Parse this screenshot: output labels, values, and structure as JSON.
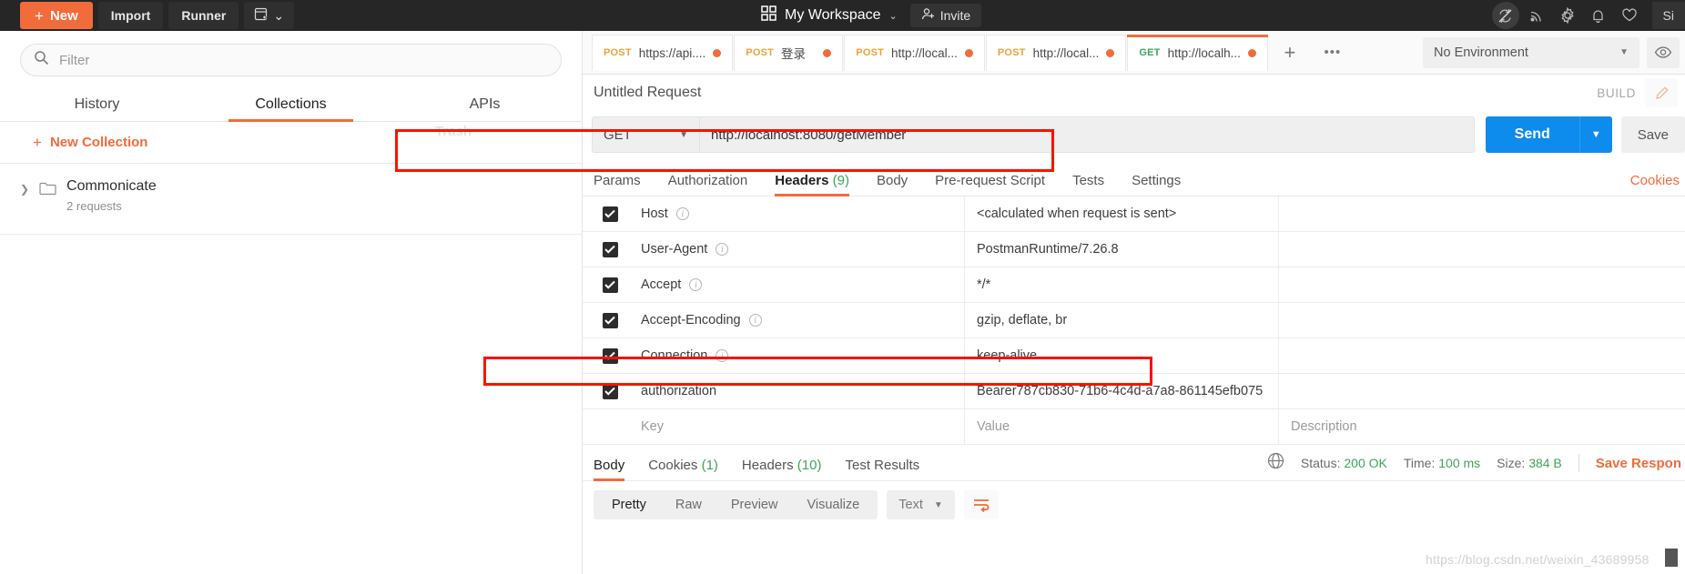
{
  "topbar": {
    "new_label": "New",
    "import_label": "Import",
    "runner_label": "Runner",
    "workspace_label": "My Workspace",
    "invite_label": "Invite",
    "signin_label": "Si",
    "icons": [
      "new-window-icon",
      "sync-off-icon",
      "broadcast-icon",
      "gear-icon",
      "bell-icon",
      "heart-icon"
    ]
  },
  "sidebar": {
    "filter_placeholder": "Filter",
    "tabs": [
      {
        "label": "History",
        "selected": false
      },
      {
        "label": "Collections",
        "selected": true
      },
      {
        "label": "APIs",
        "selected": false
      }
    ],
    "new_collection_label": "New Collection",
    "trash_label": "Trash",
    "collections": [
      {
        "name": "Commonicate",
        "sub": "2 requests"
      }
    ]
  },
  "request_tabs": [
    {
      "method": "POST",
      "name": "https://api....",
      "selected": false,
      "unsaved": true
    },
    {
      "method": "POST",
      "name": "登录",
      "selected": false,
      "unsaved": true
    },
    {
      "method": "POST",
      "name": "http://local...",
      "selected": false,
      "unsaved": true
    },
    {
      "method": "POST",
      "name": "http://local...",
      "selected": false,
      "unsaved": true
    },
    {
      "method": "GET",
      "name": "http://localh...",
      "selected": true,
      "unsaved": true
    }
  ],
  "environment": {
    "selected": "No Environment",
    "eye_icon": "eye-icon"
  },
  "request": {
    "title": "Untitled Request",
    "build_label": "BUILD",
    "method": "GET",
    "url": "http://localhost:8080/getMember",
    "send_label": "Send",
    "save_label": "Save",
    "cookies_link": "Cookies",
    "tabs": [
      {
        "label": "Params",
        "count": "",
        "selected": false
      },
      {
        "label": "Authorization",
        "count": "",
        "selected": false
      },
      {
        "label": "Headers",
        "count": "(9)",
        "selected": true
      },
      {
        "label": "Body",
        "count": "",
        "selected": false
      },
      {
        "label": "Pre-request Script",
        "count": "",
        "selected": false
      },
      {
        "label": "Tests",
        "count": "",
        "selected": false
      },
      {
        "label": "Settings",
        "count": "",
        "selected": false
      }
    ]
  },
  "headers_table": {
    "columns": {
      "key": "Key",
      "value": "Value",
      "description": "Description"
    },
    "rows": [
      {
        "checked": true,
        "key": "Host",
        "info": true,
        "value": "<calculated when request is sent>",
        "description": ""
      },
      {
        "checked": true,
        "key": "User-Agent",
        "info": true,
        "value": "PostmanRuntime/7.26.8",
        "description": ""
      },
      {
        "checked": true,
        "key": "Accept",
        "info": true,
        "value": "*/*",
        "description": ""
      },
      {
        "checked": true,
        "key": "Accept-Encoding",
        "info": true,
        "value": "gzip, deflate, br",
        "description": ""
      },
      {
        "checked": true,
        "key": "Connection",
        "info": true,
        "value": "keep-alive",
        "description": ""
      },
      {
        "checked": true,
        "key": "authorization",
        "info": false,
        "value": "Bearer787cb830-71b6-4c4d-a7a8-861145efb075",
        "description": ""
      }
    ],
    "placeholder_row": {
      "key": "Key",
      "value": "Value",
      "description": "Description"
    }
  },
  "response": {
    "tabs": [
      {
        "label": "Body",
        "count": "",
        "selected": true
      },
      {
        "label": "Cookies",
        "count": "(1)",
        "selected": false
      },
      {
        "label": "Headers",
        "count": "(10)",
        "selected": false
      },
      {
        "label": "Test Results",
        "count": "",
        "selected": false
      }
    ],
    "globe_icon": "globe-icon",
    "status_label": "Status:",
    "status_value": "200 OK",
    "time_label": "Time:",
    "time_value": "100 ms",
    "size_label": "Size:",
    "size_value": "384 B",
    "save_response_label": "Save Respon",
    "format_tabs": [
      {
        "label": "Pretty",
        "selected": true
      },
      {
        "label": "Raw",
        "selected": false
      },
      {
        "label": "Preview",
        "selected": false
      },
      {
        "label": "Visualize",
        "selected": false
      }
    ],
    "type_select": "Text",
    "wrap_icon": "wrap-lines-icon"
  },
  "watermark": "https://blog.csdn.net/weixin_43689958",
  "colors": {
    "accent": "#f26b3a",
    "send_blue": "#0d8ced",
    "get_green": "#3fa45b",
    "post_orange": "#e9a33b",
    "annotation_red": "#fb1100"
  }
}
